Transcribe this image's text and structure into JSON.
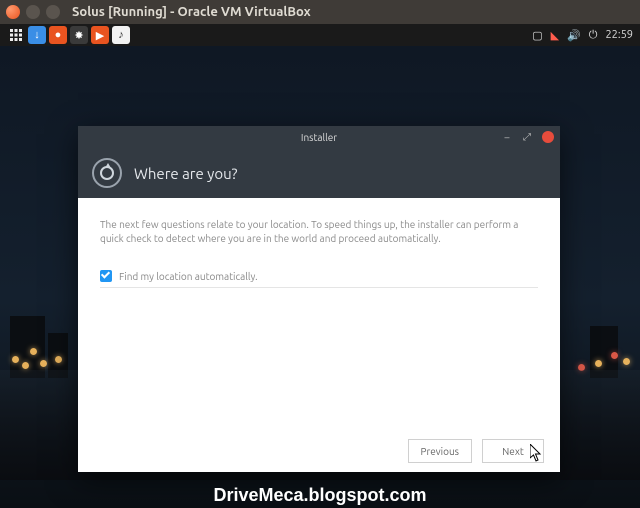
{
  "host": {
    "title": "Solus [Running] - Oracle VM VirtualBox"
  },
  "topbar": {
    "clock": "22:59"
  },
  "installer": {
    "window_title": "Installer",
    "header": "Where are you?",
    "body_text": "The next few questions relate to your location. To speed things up, the installer can perform a quick check to detect where you are in the world and proceed automatically.",
    "find_location_label": "Find my location automatically.",
    "find_location_checked": true,
    "buttons": {
      "previous": "Previous",
      "next": "Next"
    }
  },
  "watermark": "DriveMeca.blogspot.com"
}
